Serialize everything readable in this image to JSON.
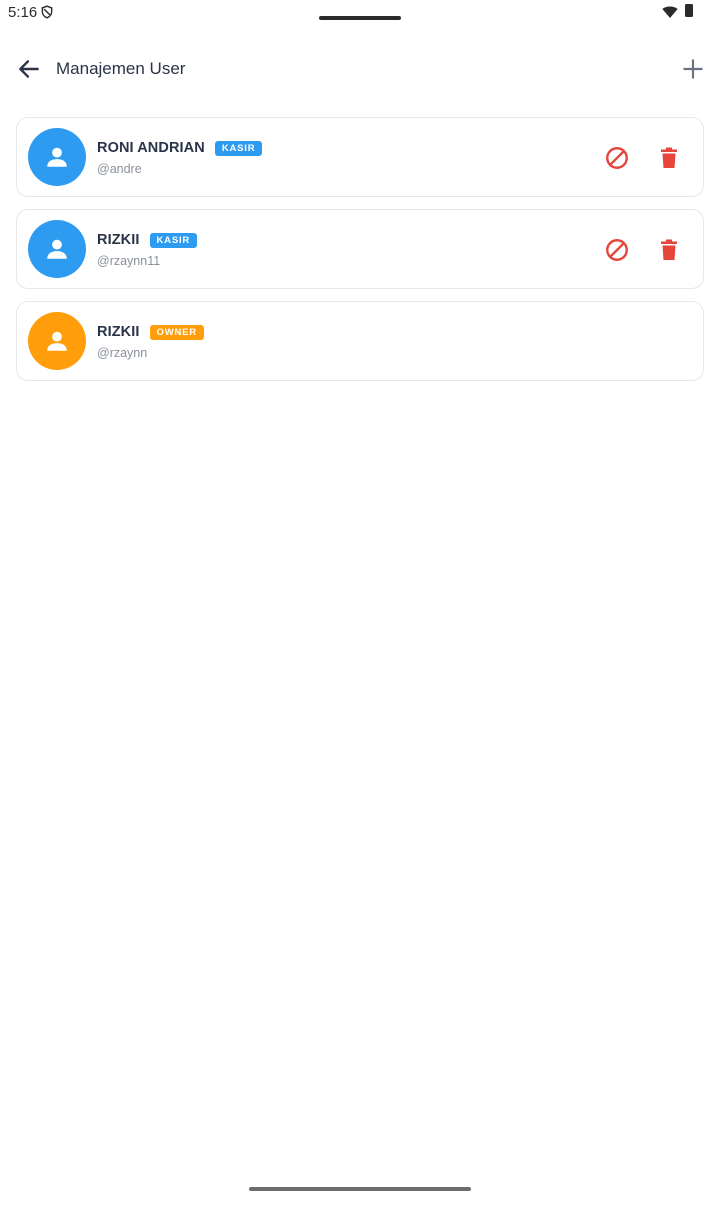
{
  "status_bar": {
    "time": "5:16",
    "icons": [
      "shield-icon",
      "wifi-icon",
      "battery-icon"
    ]
  },
  "app_bar": {
    "title": "Manajemen User",
    "back_icon": "arrow-left-icon",
    "add_icon": "plus-icon"
  },
  "colors": {
    "kasir": "#2d9cf0",
    "owner": "#ff9d0a",
    "danger": "#e5453a",
    "text": "#2a3347",
    "muted": "#8a909c"
  },
  "users": [
    {
      "name": "RONI ANDRIAN",
      "role": "KASIR",
      "handle": "@andre",
      "actions": [
        "block-icon",
        "trash-icon"
      ]
    },
    {
      "name": "RIZKII",
      "role": "KASIR",
      "handle": "@rzaynn11",
      "actions": [
        "block-icon",
        "trash-icon"
      ]
    },
    {
      "name": "RIZKII",
      "role": "OWNER",
      "handle": "@rzaynn",
      "actions": []
    }
  ]
}
